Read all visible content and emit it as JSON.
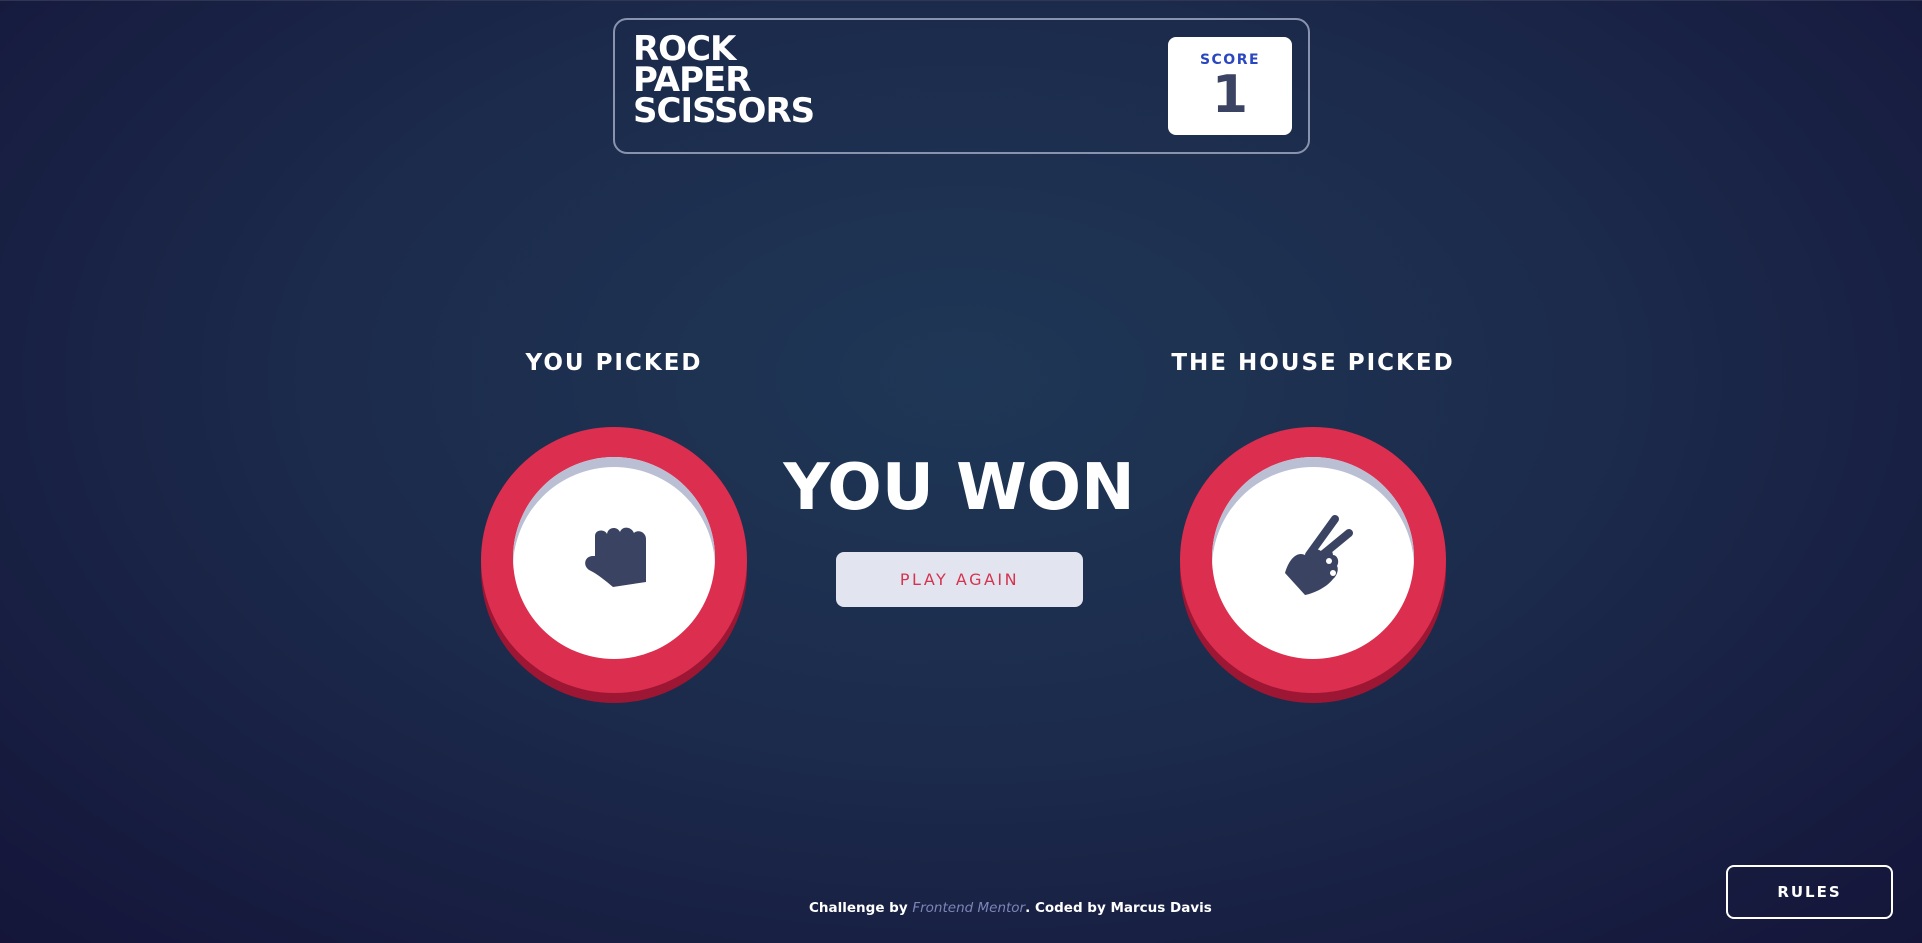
{
  "header": {
    "title_lines": [
      "ROCK",
      "PAPER",
      "SCISSORS"
    ],
    "score_label": "SCORE",
    "score_value": "1"
  },
  "game": {
    "player_label": "YOU PICKED",
    "house_label": "THE HOUSE PICKED",
    "player_pick": "rock",
    "house_pick": "scissors",
    "player_icon": "rock-hand-icon",
    "house_icon": "scissors-hand-icon",
    "result": "YOU WON",
    "play_again_label": "PLAY AGAIN"
  },
  "footer": {
    "prefix": "Challenge by ",
    "link_text": "Frontend Mentor",
    "suffix": ". Coded by Marcus Davis"
  },
  "rules_label": "RULES",
  "colors": {
    "background": "#1f3756",
    "token_ring": "#dc2e4e",
    "token_ring_shadow": "#9d1634",
    "score_label": "#2a46c0",
    "dark_text": "#3b4363",
    "play_again_text": "#d5334f"
  }
}
